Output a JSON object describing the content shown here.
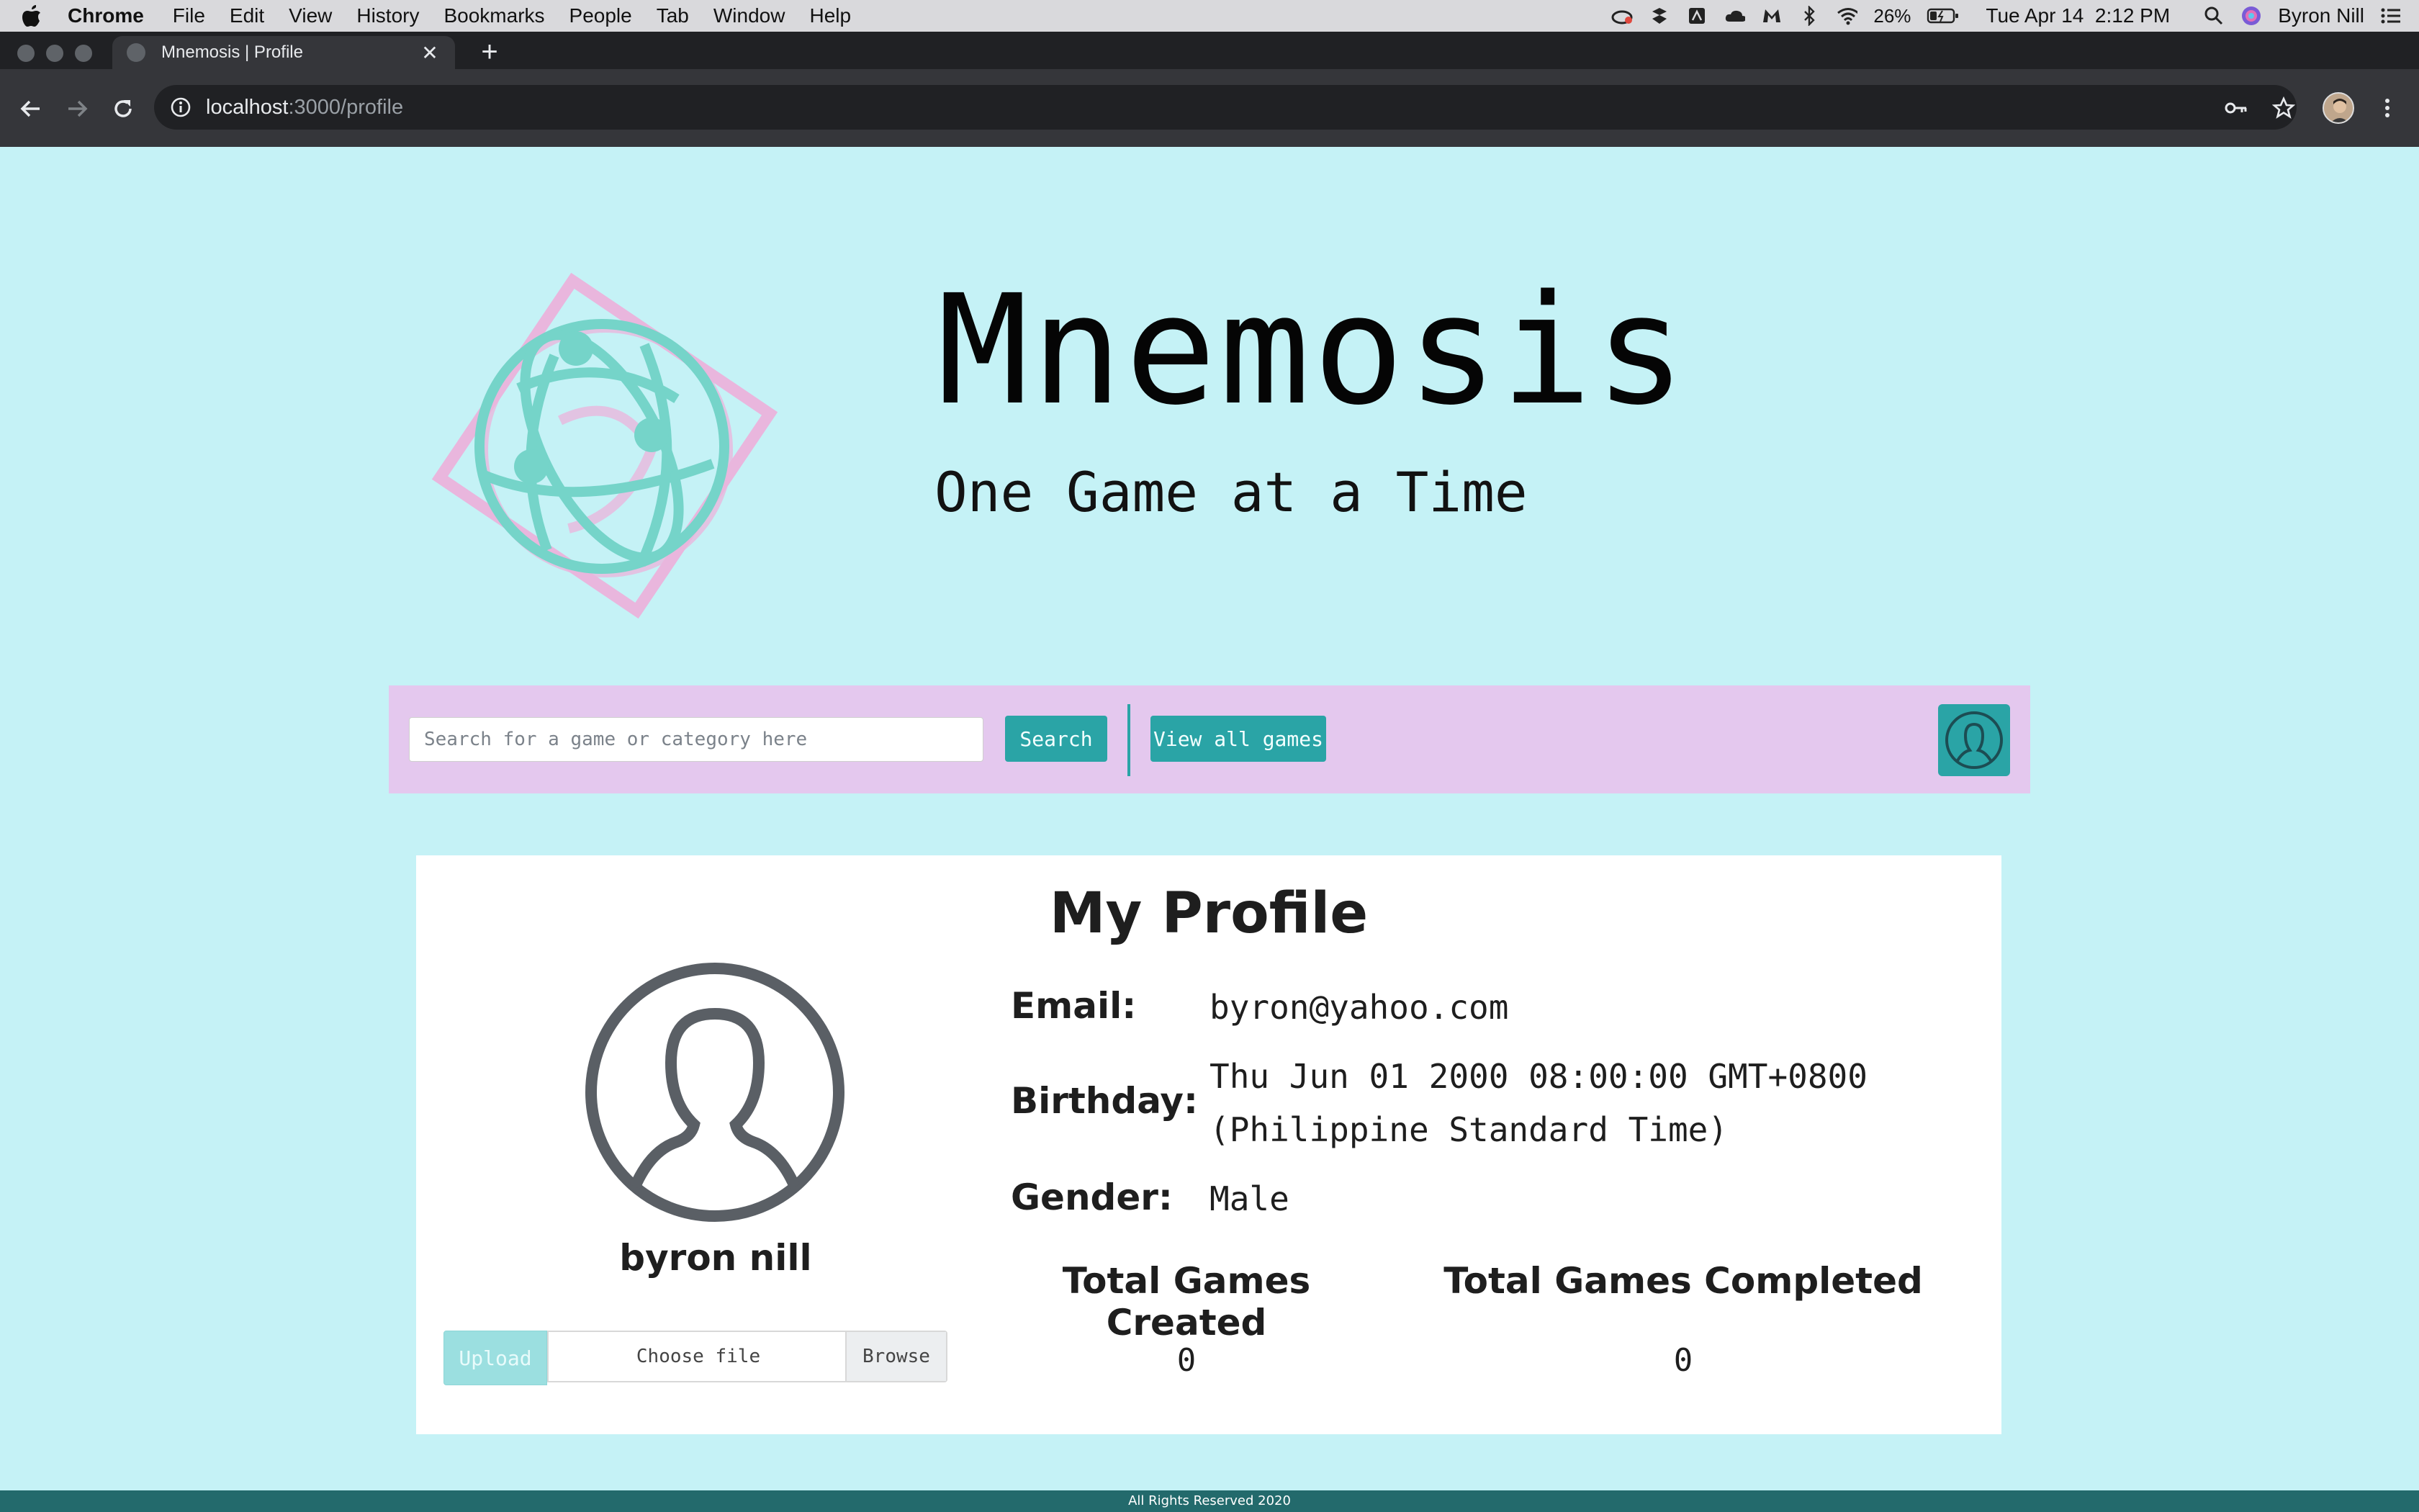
{
  "menubar": {
    "app_name": "Chrome",
    "items": [
      "File",
      "Edit",
      "View",
      "History",
      "Bookmarks",
      "People",
      "Tab",
      "Window",
      "Help"
    ],
    "battery": "26%",
    "datetime": "Tue Apr 14  2:12 PM",
    "user": "Byron Nill"
  },
  "browser": {
    "tab_title": "Mnemosis | Profile",
    "url_host": "localhost",
    "url_path": ":3000/profile"
  },
  "header": {
    "title": "Mnemosis",
    "tagline": "One Game at a Time",
    "colors": {
      "globe": "#75d4c9",
      "frame": "#e9b6dd"
    }
  },
  "nav": {
    "search_placeholder": "Search for a game or category here",
    "search_label": "Search",
    "view_all_label": "View all games"
  },
  "profile": {
    "heading": "My Profile",
    "username": "byron nill",
    "upload_label": "Upload",
    "choose_file_label": "Choose file",
    "browse_label": "Browse",
    "email_label": "Email:",
    "email": "byron@yahoo.com",
    "birthday_label": "Birthday:",
    "birthday_line1": "Thu Jun 01 2000 08:00:00 GMT+0800",
    "birthday_line2": "(Philippine Standard Time)",
    "gender_label": "Gender:",
    "gender": "Male",
    "stats": [
      {
        "label": "Total Games Created",
        "value": "0"
      },
      {
        "label": "Total Games Completed",
        "value": "0"
      }
    ]
  },
  "footer": {
    "text": "All Rights Reserved 2020"
  },
  "colors": {
    "accent": "#2aa4a6",
    "page_bg": "#c5f2f6",
    "nav_bg": "#e4c8ee",
    "footer_bg": "#236a6c"
  }
}
